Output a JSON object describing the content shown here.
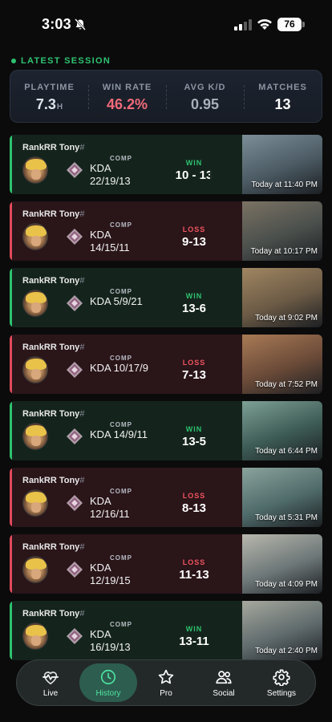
{
  "status_bar": {
    "time": "3:03",
    "battery": "76"
  },
  "section": {
    "label": "LATEST SESSION"
  },
  "summary": {
    "stats": [
      {
        "label": "PLAYTIME",
        "value": "7.3",
        "unit": "H"
      },
      {
        "label": "WIN RATE",
        "value": "46.2%"
      },
      {
        "label": "AVG K/D",
        "value": "0.95"
      },
      {
        "label": "MATCHES",
        "value": "13"
      }
    ]
  },
  "matches": [
    {
      "player": "RankRR Tony",
      "tag": "#",
      "mode": "COMP",
      "kda": [
        "KDA",
        "22/19/13"
      ],
      "result": "WIN",
      "score": "10 - 13",
      "time": "Today at 11:40 PM",
      "map_colors": [
        "#4b5a63",
        "#7d8e98"
      ]
    },
    {
      "player": "RankRR Tony",
      "tag": "#",
      "mode": "COMP",
      "kda": [
        "KDA",
        "14/15/11"
      ],
      "result": "LOSS",
      "score": "9-13",
      "time": "Today at 10:17 PM",
      "map_colors": [
        "#4a4f4c",
        "#7b7263"
      ]
    },
    {
      "player": "RankRR Tony",
      "tag": "#",
      "mode": "COMP",
      "kda": [
        "KDA 5/9/21",
        ""
      ],
      "result": "WIN",
      "score": "13-6",
      "time": "Today at 9:02 PM",
      "map_colors": [
        "#6b5a45",
        "#a08662"
      ]
    },
    {
      "player": "RankRR Tony",
      "tag": "#",
      "mode": "COMP",
      "kda": [
        "KDA 10/17/9",
        ""
      ],
      "result": "LOSS",
      "score": "7-13",
      "time": "Today at 7:52 PM",
      "map_colors": [
        "#6a4a38",
        "#a87a55"
      ]
    },
    {
      "player": "RankRR Tony",
      "tag": "#",
      "mode": "COMP",
      "kda": [
        "KDA 14/9/11",
        ""
      ],
      "result": "WIN",
      "score": "13-5",
      "time": "Today at 6:44 PM",
      "map_colors": [
        "#3d5b55",
        "#7ea095"
      ]
    },
    {
      "player": "RankRR Tony",
      "tag": "#",
      "mode": "COMP",
      "kda": [
        "KDA",
        "12/16/11"
      ],
      "result": "LOSS",
      "score": "8-13",
      "time": "Today at 5:31 PM",
      "map_colors": [
        "#4f6a6a",
        "#8aa39c"
      ]
    },
    {
      "player": "RankRR Tony",
      "tag": "#",
      "mode": "COMP",
      "kda": [
        "KDA",
        "12/19/15"
      ],
      "result": "LOSS",
      "score": "11-13",
      "time": "Today at 4:09 PM",
      "map_colors": [
        "#6d7778",
        "#b8b8ad"
      ]
    },
    {
      "player": "RankRR Tony",
      "tag": "#",
      "mode": "COMP",
      "kda": [
        "KDA",
        "16/19/13"
      ],
      "result": "WIN",
      "score": "13-11",
      "time": "Today at 2:40 PM",
      "map_colors": [
        "#5f6a6c",
        "#a6a99e"
      ]
    }
  ],
  "nav": {
    "tabs": [
      {
        "label": "Live",
        "icon": "pulse-icon"
      },
      {
        "label": "History",
        "icon": "clock-icon",
        "active": true
      },
      {
        "label": "Pro",
        "icon": "star-icon"
      },
      {
        "label": "Social",
        "icon": "people-icon"
      },
      {
        "label": "Settings",
        "icon": "gear-icon"
      }
    ]
  },
  "colors": {
    "win": "#2ec26f",
    "loss": "#e04b5c",
    "accent_text": "#4ee3a1"
  }
}
